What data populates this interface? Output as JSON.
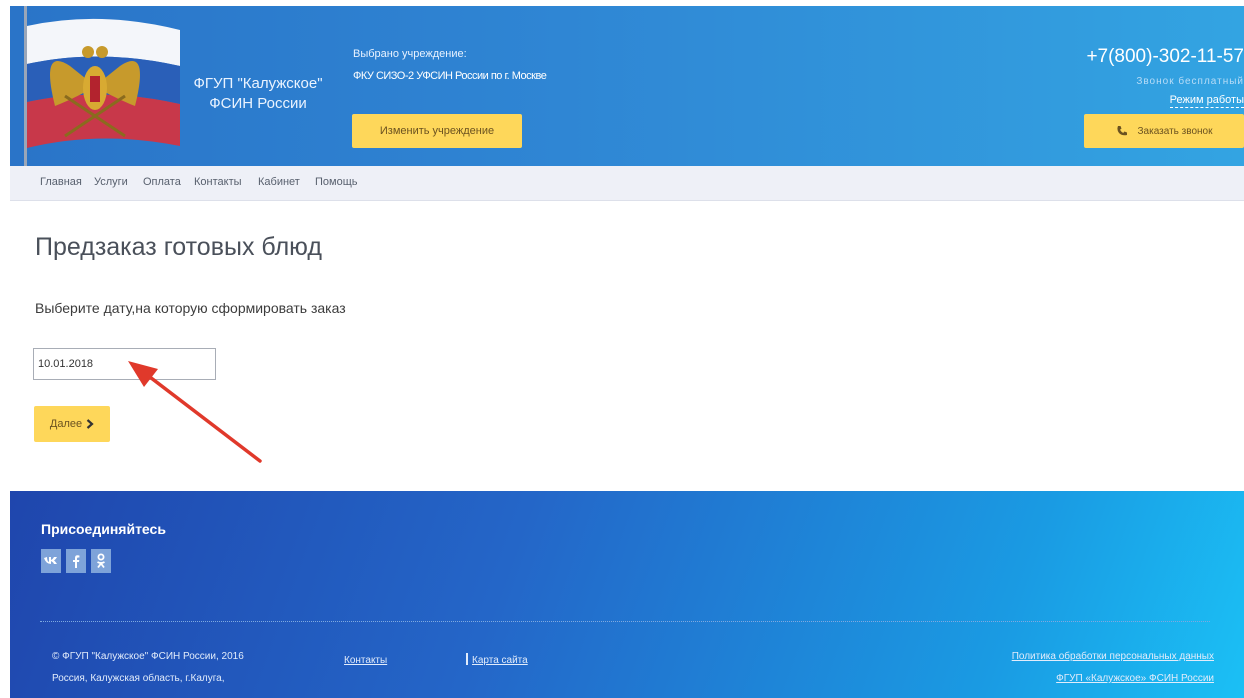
{
  "header": {
    "org_name": "ФГУП \"Калужское\" ФСИН России",
    "selected_label": "Выбрано учреждение:",
    "selected_value": "ФКУ СИЗО-2 УФСИН России по г. Москве",
    "change_button": "Изменить учреждение",
    "phone": "+7(800)-302-11-57",
    "free_call": "Звонок бесплатный",
    "work_mode": "Режим работы",
    "callback_button": "Заказать звонок"
  },
  "nav": {
    "items": [
      "Главная",
      "Услуги",
      "Оплата",
      "Контакты",
      "Кабинет",
      "Помощь"
    ]
  },
  "main": {
    "title": "Предзаказ готовых блюд",
    "instruction": "Выберите дату,на которую сформировать заказ",
    "date_value": "10.01.2018",
    "next_button": "Далее"
  },
  "footer": {
    "join_title": "Присоединяйтесь",
    "social": [
      "vk-icon",
      "facebook-icon",
      "odnoklassniki-icon"
    ],
    "copyright_line1": "© ФГУП \"Калужское\" ФСИН России, 2016",
    "copyright_line2": "Россия, Калужская область, г.Калуга,",
    "link_contacts": "Контакты",
    "link_sitemap": "Карта сайта",
    "link_privacy": "Политика обработки персональных данных",
    "link_org": "ФГУП «Калужское» ФСИН России"
  },
  "colors": {
    "accent_yellow": "#fed75a",
    "header_blue": "#2f86d4",
    "arrow_red": "#e0392b"
  }
}
